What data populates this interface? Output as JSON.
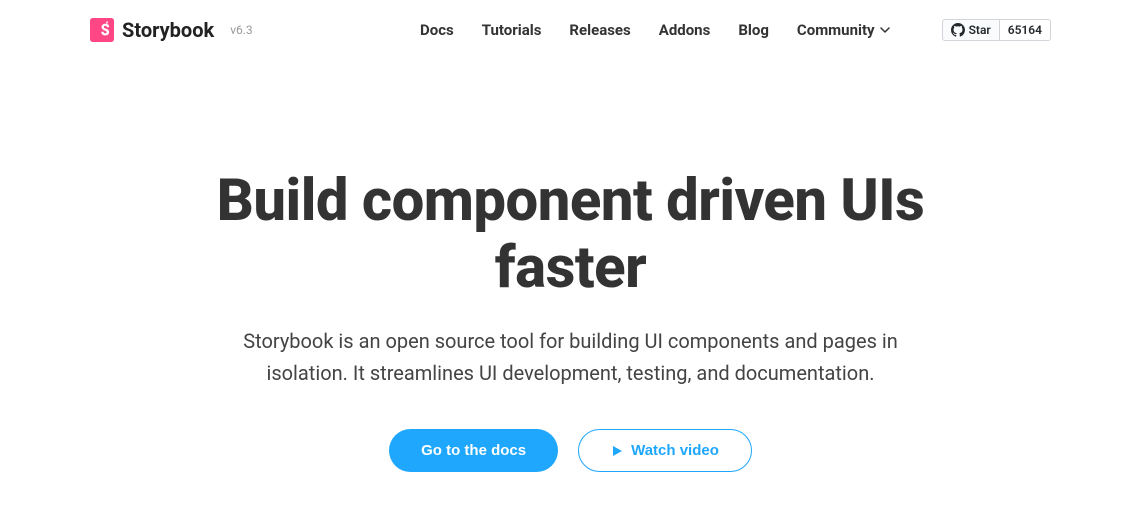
{
  "header": {
    "brand": "Storybook",
    "version": "v6.3",
    "nav": {
      "docs": "Docs",
      "tutorials": "Tutorials",
      "releases": "Releases",
      "addons": "Addons",
      "blog": "Blog",
      "community": "Community"
    },
    "github": {
      "star_label": "Star",
      "star_count": "65164"
    }
  },
  "hero": {
    "title": "Build component driven UIs faster",
    "subtitle": "Storybook is an open source tool for building UI components and pages in isolation. It streamlines UI development, testing, and documentation.",
    "cta_primary": "Go to the docs",
    "cta_secondary": "Watch video"
  }
}
